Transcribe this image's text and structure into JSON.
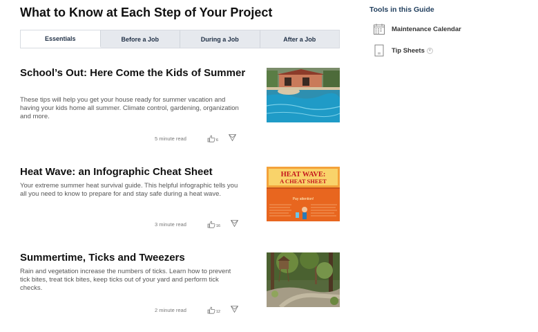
{
  "page": {
    "title": "What to Know at Each Step of Your Project"
  },
  "tabs": [
    {
      "label": "Essentials"
    },
    {
      "label": "Before a Job"
    },
    {
      "label": "During a Job"
    },
    {
      "label": "After a Job"
    }
  ],
  "articles": [
    {
      "title": "School’s Out: Here Come the Kids of Summer",
      "description": "These tips will help you get your house ready for summer vacation and having your kids home all summer. Climate control, gardening, organization and more.",
      "read_time": "5 minute read",
      "likes": "6"
    },
    {
      "title": "Heat Wave: an Infographic Cheat Sheet",
      "description": "Your extreme summer heat survival guide. This helpful infographic tells you all you need to know to prepare for and stay safe during a heat wave.",
      "read_time": "3 minute read",
      "likes": "16",
      "image_text": {
        "heading_1": "HEAT WAVE:",
        "heading_2": "A CHEAT SHEET",
        "callout": "Pay attention!"
      }
    },
    {
      "title": "Summertime, Ticks and Tweezers",
      "description": "Rain and vegetation increase the numbers of ticks. Learn how to prevent tick bites, treat tick bites, keep ticks out of your yard and perform tick checks.",
      "read_time": "2 minute read",
      "likes": "12"
    }
  ],
  "sidebar": {
    "title": "Tools in this Guide",
    "tools": [
      {
        "label": "Maintenance Calendar",
        "icon": "calendar-icon"
      },
      {
        "label": "Tip Sheets",
        "icon": "document-icon",
        "expand_glyph": "v"
      }
    ]
  },
  "colors": {
    "tab_bar": "#e6e9ee",
    "sidebar_title": "#1f3d5c",
    "heat_wave_bg": "#e8661f",
    "heat_wave_title": "#c4161c"
  }
}
